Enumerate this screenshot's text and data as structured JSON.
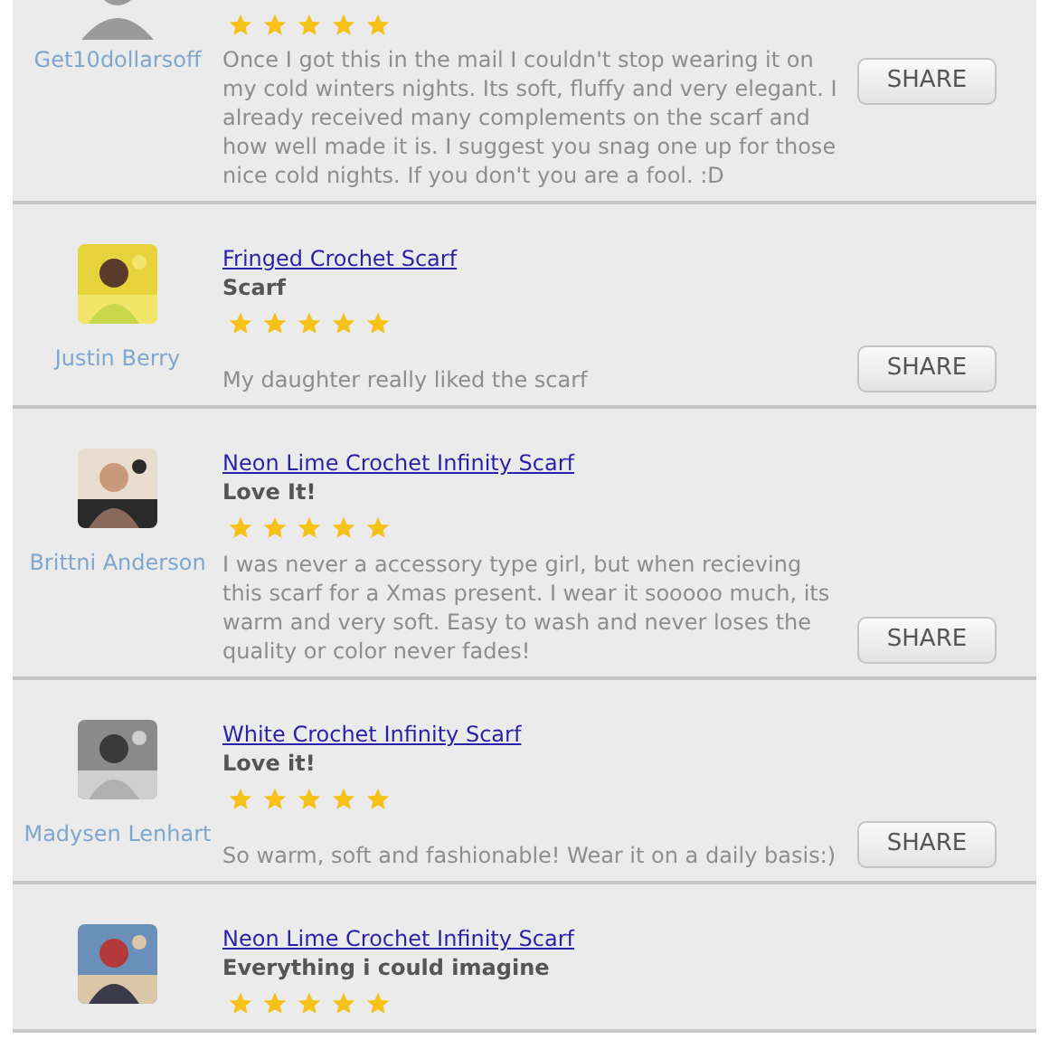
{
  "reviews": [
    {
      "avatar": {
        "kind": "default"
      },
      "stars": 5,
      "reviewer": "Get10dollarsoff",
      "text": "Once I got this in the mail I couldn't stop wearing it on my cold winters nights. Its soft, fluffy and very elegant. I already received many complements on the scarf and how well made it is. I suggest you snag one up for those nice cold nights. If you don't you are a fool. :D",
      "share": "SHARE"
    },
    {
      "product": "Fringed Crochet Scarf",
      "headline": "Scarf",
      "stars": 5,
      "reviewer": "Justin Berry",
      "text": "My daughter really liked the scarf",
      "share": "SHARE"
    },
    {
      "product": "Neon Lime Crochet Infinity Scarf",
      "headline": "Love It!",
      "stars": 5,
      "reviewer": "Brittni Anderson",
      "text": "I was never a accessory type girl, but when recieving this scarf for a Xmas present. I wear it sooooo much, its warm and very soft. Easy to wash and never loses the quality or color never fades!",
      "share": "SHARE"
    },
    {
      "product": "White Crochet Infinity Scarf",
      "headline": "Love it!",
      "stars": 5,
      "reviewer": "Madysen Lenhart",
      "text": "So warm, soft and fashionable! Wear it on a daily basis:)",
      "share": "SHARE"
    },
    {
      "product": "Neon Lime Crochet Infinity Scarf",
      "headline": "Everything i could imagine",
      "stars": 5
    }
  ]
}
